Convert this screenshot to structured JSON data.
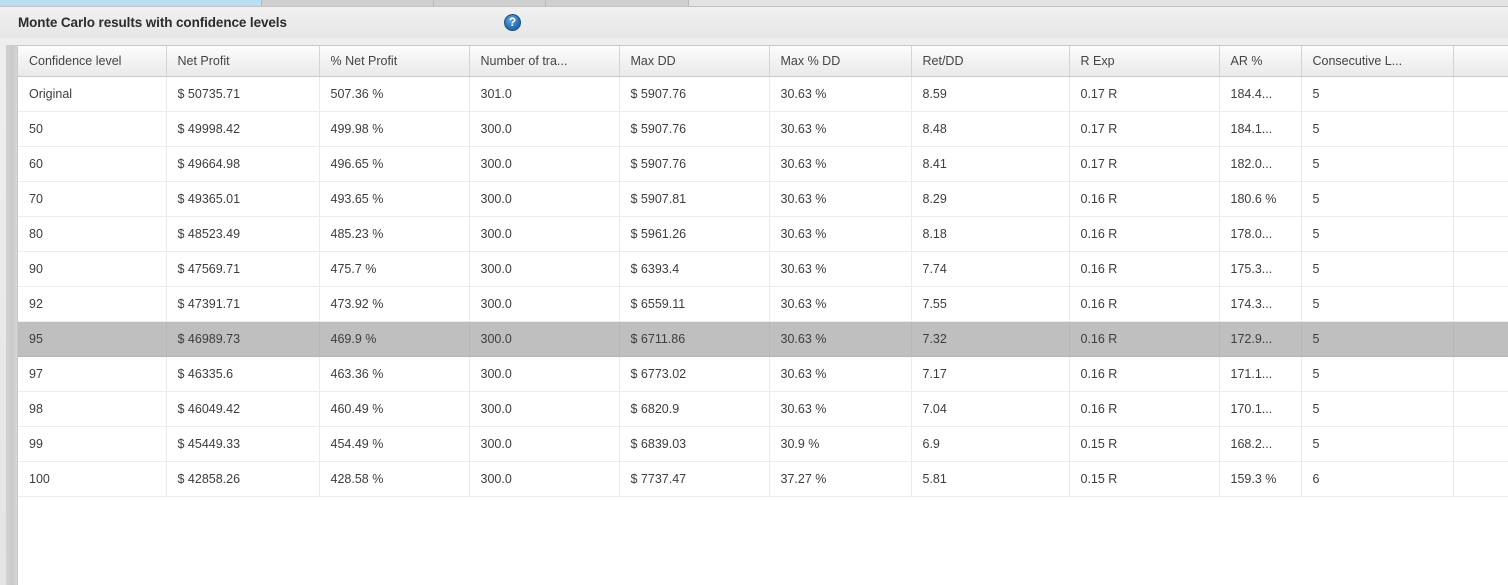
{
  "window": {
    "tab_strip": [
      "",
      "",
      "",
      ""
    ]
  },
  "panel": {
    "title": "Monte Carlo results with confidence levels",
    "help_icon_glyph": "?",
    "help_icon_name": "help-icon",
    "accent_color": "#b9dff0",
    "selected_row_color": "#bfbfbf",
    "header_bg_color": "#f1f1f1"
  },
  "table": {
    "columns": [
      "Confidence level",
      "Net Profit",
      "% Net Profit",
      "Number of tra...",
      "Max DD",
      "Max % DD",
      "Ret/DD",
      "R Exp",
      "AR %",
      "Consecutive L...",
      ""
    ],
    "selected_row_index": 7,
    "rows": [
      [
        "Original",
        "$ 50735.71",
        "507.36 %",
        "301.0",
        "$ 5907.76",
        "30.63 %",
        "8.59",
        "0.17 R",
        "184.4...",
        "5",
        ""
      ],
      [
        "50",
        "$ 49998.42",
        "499.98 %",
        "300.0",
        "$ 5907.76",
        "30.63 %",
        "8.48",
        "0.17 R",
        "184.1...",
        "5",
        ""
      ],
      [
        "60",
        "$ 49664.98",
        "496.65 %",
        "300.0",
        "$ 5907.76",
        "30.63 %",
        "8.41",
        "0.17 R",
        "182.0...",
        "5",
        ""
      ],
      [
        "70",
        "$ 49365.01",
        "493.65 %",
        "300.0",
        "$ 5907.81",
        "30.63 %",
        "8.29",
        "0.16 R",
        "180.6 %",
        "5",
        ""
      ],
      [
        "80",
        "$ 48523.49",
        "485.23 %",
        "300.0",
        "$ 5961.26",
        "30.63 %",
        "8.18",
        "0.16 R",
        "178.0...",
        "5",
        ""
      ],
      [
        "90",
        "$ 47569.71",
        "475.7 %",
        "300.0",
        "$ 6393.4",
        "30.63 %",
        "7.74",
        "0.16 R",
        "175.3...",
        "5",
        ""
      ],
      [
        "92",
        "$ 47391.71",
        "473.92 %",
        "300.0",
        "$ 6559.11",
        "30.63 %",
        "7.55",
        "0.16 R",
        "174.3...",
        "5",
        ""
      ],
      [
        "95",
        "$ 46989.73",
        "469.9 %",
        "300.0",
        "$ 6711.86",
        "30.63 %",
        "7.32",
        "0.16 R",
        "172.9...",
        "5",
        ""
      ],
      [
        "97",
        "$ 46335.6",
        "463.36 %",
        "300.0",
        "$ 6773.02",
        "30.63 %",
        "7.17",
        "0.16 R",
        "171.1...",
        "5",
        ""
      ],
      [
        "98",
        "$ 46049.42",
        "460.49 %",
        "300.0",
        "$ 6820.9",
        "30.63 %",
        "7.04",
        "0.16 R",
        "170.1...",
        "5",
        ""
      ],
      [
        "99",
        "$ 45449.33",
        "454.49 %",
        "300.0",
        "$ 6839.03",
        "30.9 %",
        "6.9",
        "0.15 R",
        "168.2...",
        "5",
        ""
      ],
      [
        "100",
        "$ 42858.26",
        "428.58 %",
        "300.0",
        "$ 7737.47",
        "37.27 %",
        "5.81",
        "0.15 R",
        "159.3 %",
        "6",
        ""
      ]
    ]
  }
}
